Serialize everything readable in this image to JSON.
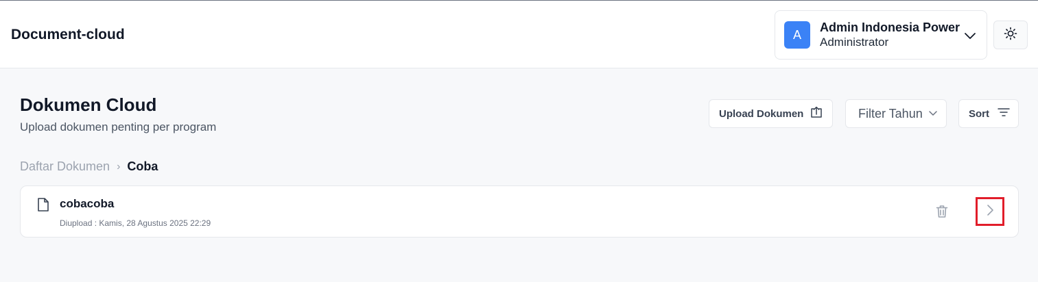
{
  "app": {
    "title": "Document-cloud"
  },
  "user": {
    "initial": "A",
    "name": "Admin Indonesia Power",
    "role": "Administrator"
  },
  "page": {
    "title": "Dokumen Cloud",
    "subtitle": "Upload dokumen penting per program"
  },
  "actions": {
    "upload_label": "Upload Dokumen",
    "filter_label": "Filter Tahun",
    "sort_label": "Sort"
  },
  "breadcrumb": {
    "root": "Daftar Dokumen",
    "separator": "›",
    "current": "Coba"
  },
  "documents": [
    {
      "name": "cobacoba",
      "uploaded": "Diupload : Kamis, 28 Agustus 2025 22:29"
    }
  ],
  "colors": {
    "avatar_bg": "#3b82f6",
    "highlight": "#e11d2a"
  },
  "icons": [
    "chevron-down-icon",
    "sun-icon",
    "upload-icon",
    "filter-lines-icon",
    "file-icon",
    "trash-icon",
    "chevron-right-icon"
  ]
}
